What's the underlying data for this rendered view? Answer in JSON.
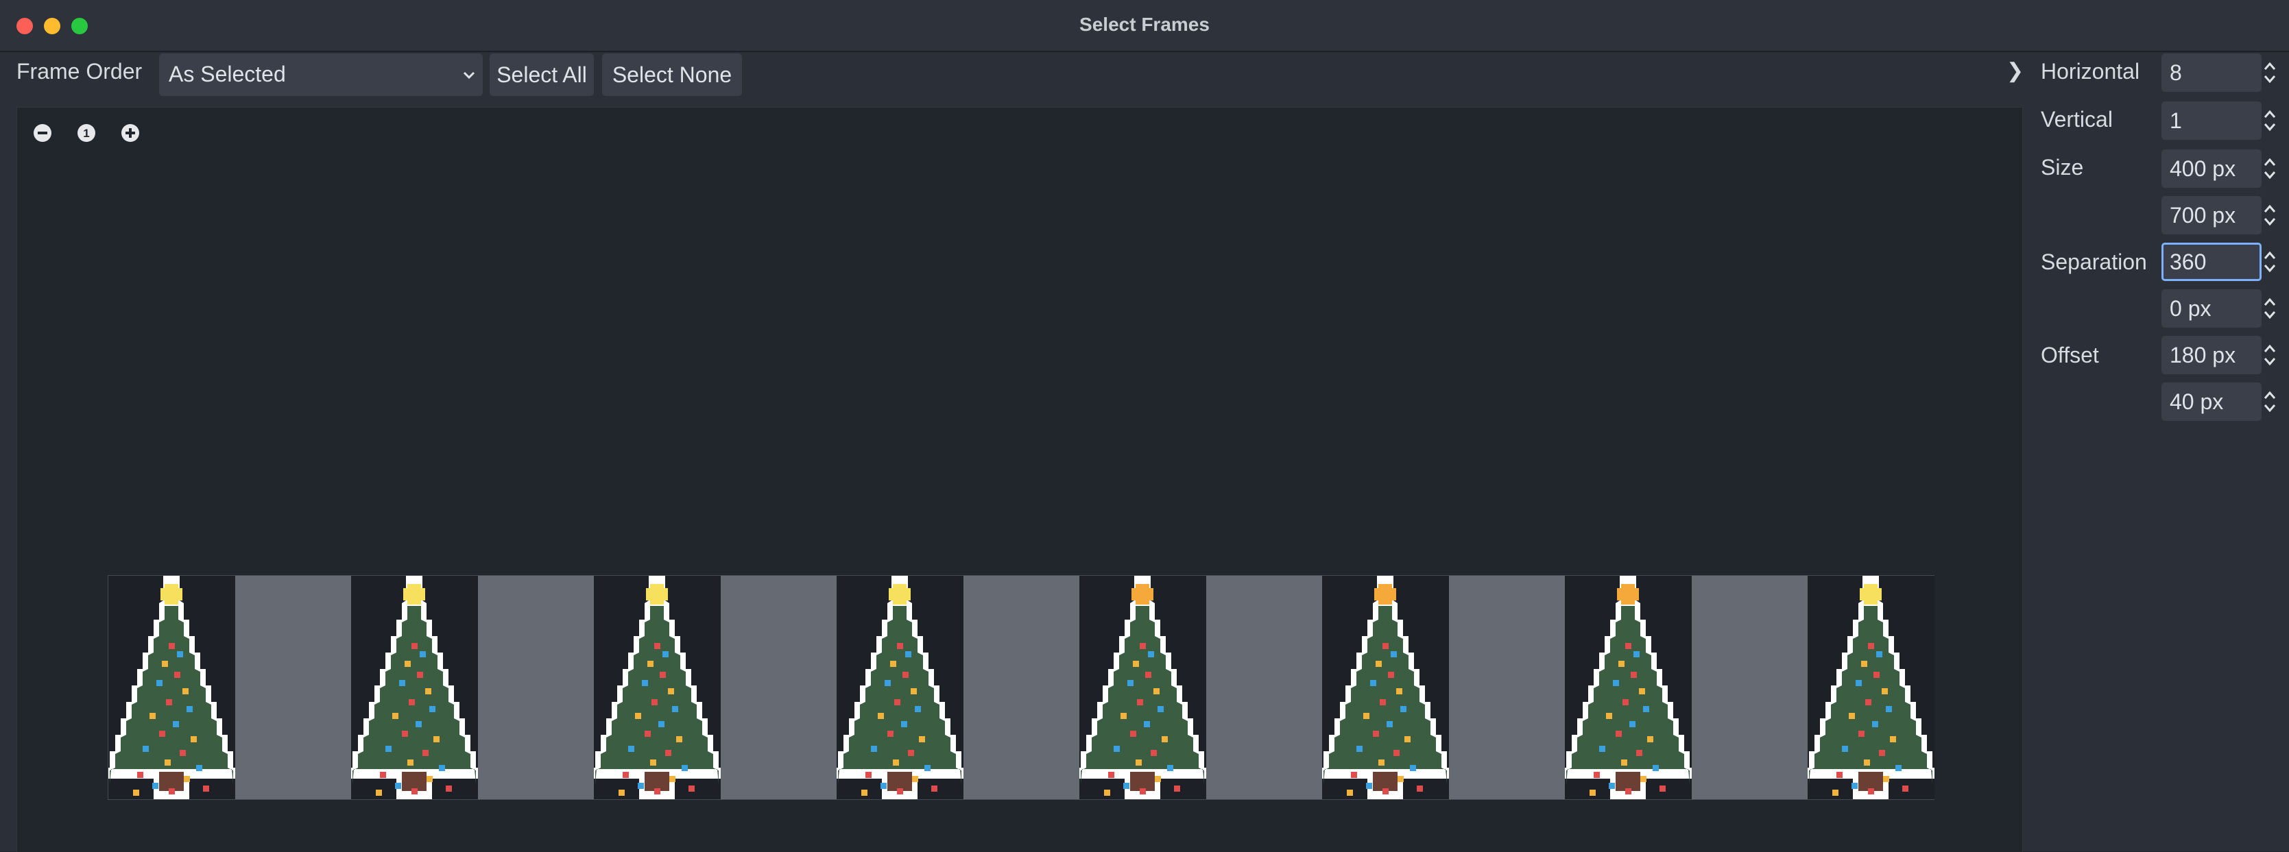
{
  "window": {
    "title": "Select Frames"
  },
  "toolbar": {
    "frame_order_label": "Frame Order",
    "frame_order_value": "As Selected",
    "select_all_label": "Select All",
    "select_none_label": "Select None",
    "collapse_glyph": "❯"
  },
  "zoom": {
    "reset_label": "1"
  },
  "sheet": {
    "frame_count": 8,
    "star_colors": [
      "#f6e05e",
      "#f6e05e",
      "#f6e05e",
      "#f6e05e",
      "#f6a93b",
      "#f6a93b",
      "#f6a93b",
      "#f6e05e"
    ]
  },
  "properties": {
    "horizontal": {
      "label": "Horizontal",
      "value": "8"
    },
    "vertical": {
      "label": "Vertical",
      "value": "1"
    },
    "size": {
      "label": "Size",
      "x": "400 px",
      "y": "700 px"
    },
    "separation": {
      "label": "Separation",
      "x": "360",
      "y": "0 px"
    },
    "offset": {
      "label": "Offset",
      "x": "180 px",
      "y": "40 px"
    }
  },
  "colors": {
    "accent_focus": "#7db1ff",
    "tree_green": "#3b5e43",
    "trunk": "#6b3f34"
  }
}
